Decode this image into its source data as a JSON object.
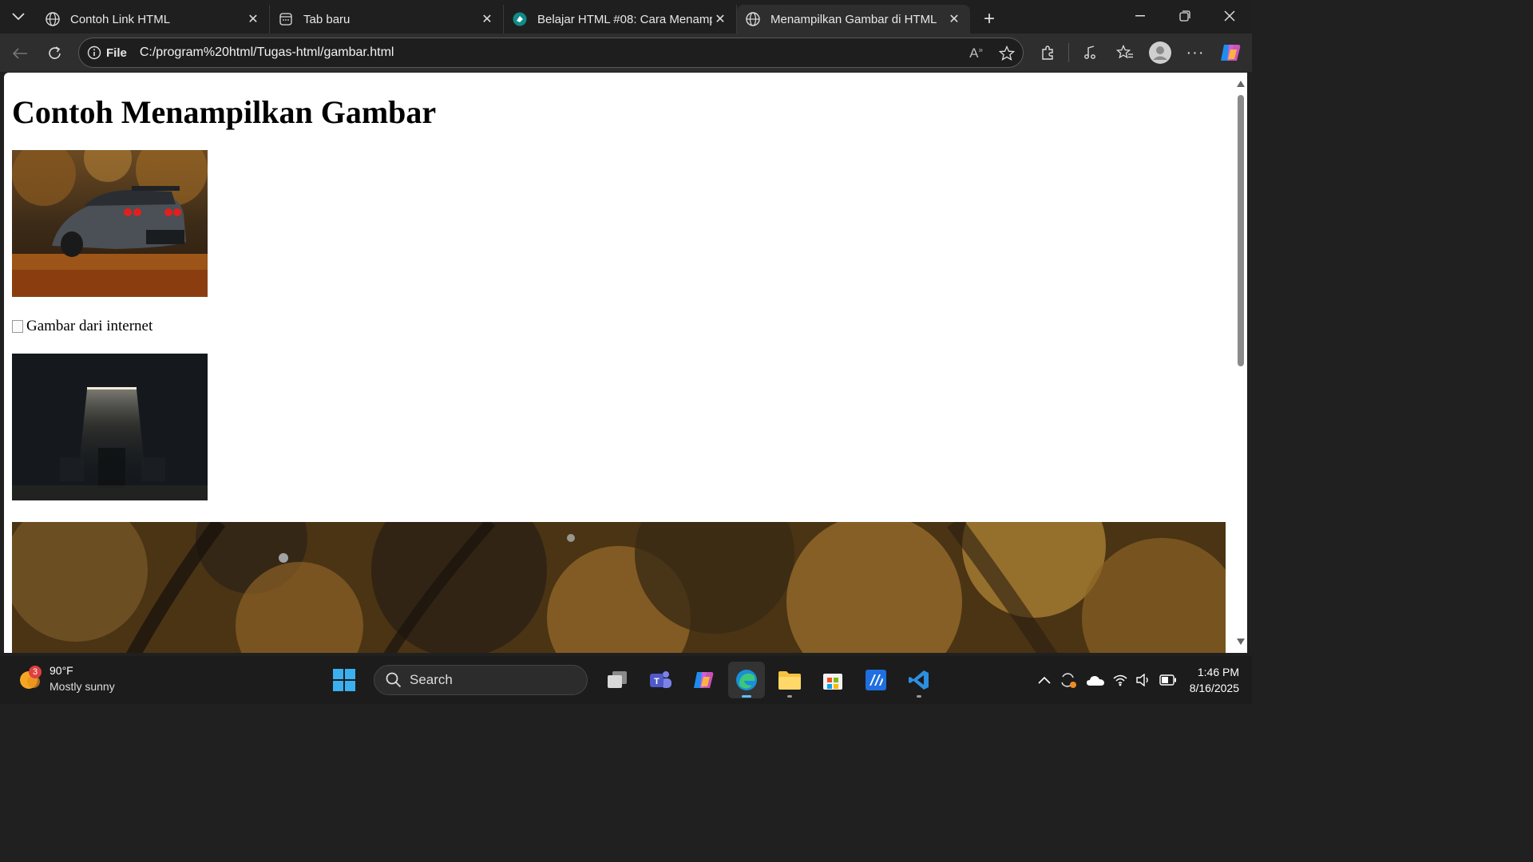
{
  "browser": {
    "tabs": [
      {
        "title": "Contoh Link HTML",
        "icon": "globe-icon",
        "active": false
      },
      {
        "title": "Tab baru",
        "icon": "newtab-page-icon",
        "active": false
      },
      {
        "title": "Belajar HTML #08: Cara Menampi",
        "icon": "petanikode-icon",
        "active": false
      },
      {
        "title": "Menampilkan Gambar di HTML",
        "icon": "globe-icon",
        "active": true
      }
    ],
    "address": {
      "scheme_label": "File",
      "url": "C:/program%20html/Tugas-html/gambar.html"
    }
  },
  "page": {
    "heading": "Contoh Menampilkan Gambar",
    "broken_image_alt": "Gambar dari internet"
  },
  "taskbar": {
    "weather": {
      "badge": "3",
      "temp": "90°F",
      "condition": "Mostly sunny"
    },
    "search_placeholder": "Search",
    "clock": {
      "time": "1:46 PM",
      "date": "8/16/2025"
    }
  }
}
